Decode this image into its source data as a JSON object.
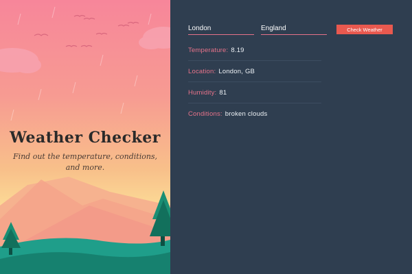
{
  "hero": {
    "title": "Weather Checker",
    "subtitle_line1": "Find out the temperature, conditions,",
    "subtitle_line2": "and more."
  },
  "form": {
    "city_value": "London",
    "country_value": "England",
    "button_label": "Check Weather"
  },
  "results": [
    {
      "label": "Temperature:",
      "value": "8.19"
    },
    {
      "label": "Location:",
      "value": "London, GB"
    },
    {
      "label": "Humidity:",
      "value": "81"
    },
    {
      "label": "Conditions:",
      "value": "broken clouds"
    }
  ],
  "colors": {
    "panel_bg": "#2f3e50",
    "accent": "#e8738a",
    "button": "#e9594f"
  }
}
